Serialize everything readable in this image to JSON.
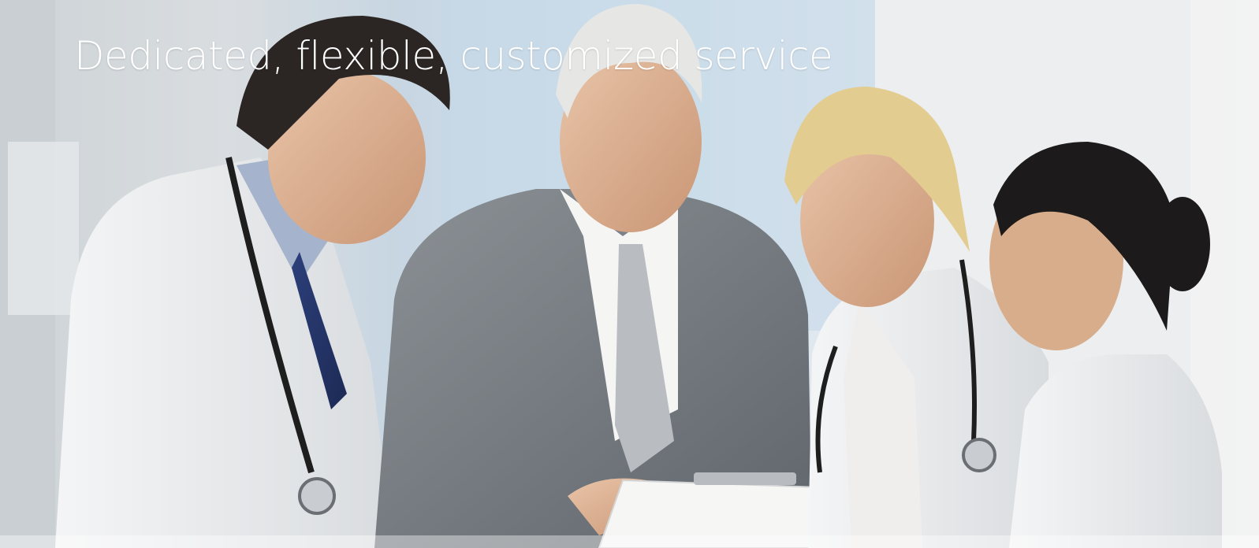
{
  "hero": {
    "headline": "Dedicated, flexible, customized service",
    "image_subject": "four medical professionals reviewing a clipboard",
    "headline_color": "#ffffff"
  },
  "icons": {
    "stethoscope": "stethoscope-icon",
    "clipboard": "clipboard-icon"
  }
}
